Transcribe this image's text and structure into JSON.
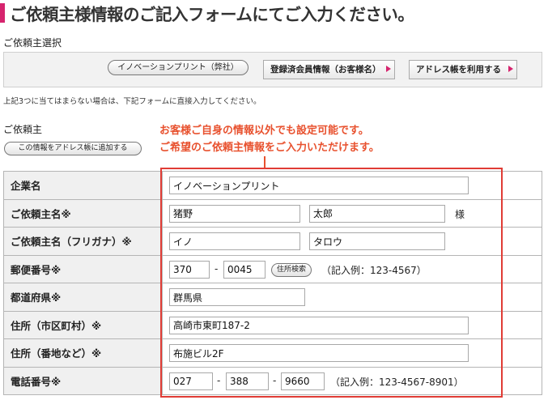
{
  "page_title": "ご依頼主様情報のご記入フォームにてご入力ください。",
  "client_select": {
    "label": "ご依頼主選択",
    "company_button": "イノベーションプリント（弊社）",
    "member_button": "登録済会員情報（お客様名）",
    "address_book_button": "アドレス帳を利用する"
  },
  "note": "上記3つに当てはまらない場合は、下記フォームに直接入力してください。",
  "client_section": {
    "label": "ご依頼主",
    "add_to_book_button": "この情報をアドレス帳に追加する"
  },
  "callout": {
    "line1": "お客様ご自身の情報以外でも設定可能です。",
    "line2": "ご希望のご依頼主情報をご入力いただけます。"
  },
  "form": {
    "company": {
      "label": "企業名",
      "value": "イノベーションプリント"
    },
    "name": {
      "label": "ご依頼主名※",
      "last": "猪野",
      "first": "太郎",
      "suffix": "様"
    },
    "name_kana": {
      "label": "ご依頼主名（フリガナ）※",
      "last": "イノ",
      "first": "タロウ"
    },
    "postal": {
      "label": "郵便番号※",
      "part1": "370",
      "part2": "0045",
      "sep": "-",
      "search_button": "住所検索",
      "example": "（記入例：123-4567）"
    },
    "prefecture": {
      "label": "都道府県※",
      "value": "群馬県"
    },
    "city": {
      "label": "住所（市区町村）※",
      "value": "高崎市東町187-2"
    },
    "street": {
      "label": "住所（番地など）※",
      "value": "布施ビル2F"
    },
    "phone": {
      "label": "電話番号※",
      "part1": "027",
      "part2": "388",
      "part3": "9660",
      "sep": "-",
      "example": "（記入例：123-4567-8901）"
    }
  },
  "colors": {
    "accent": "#d6246e",
    "callout": "#e8512e",
    "highlight_border": "#e03c35"
  }
}
